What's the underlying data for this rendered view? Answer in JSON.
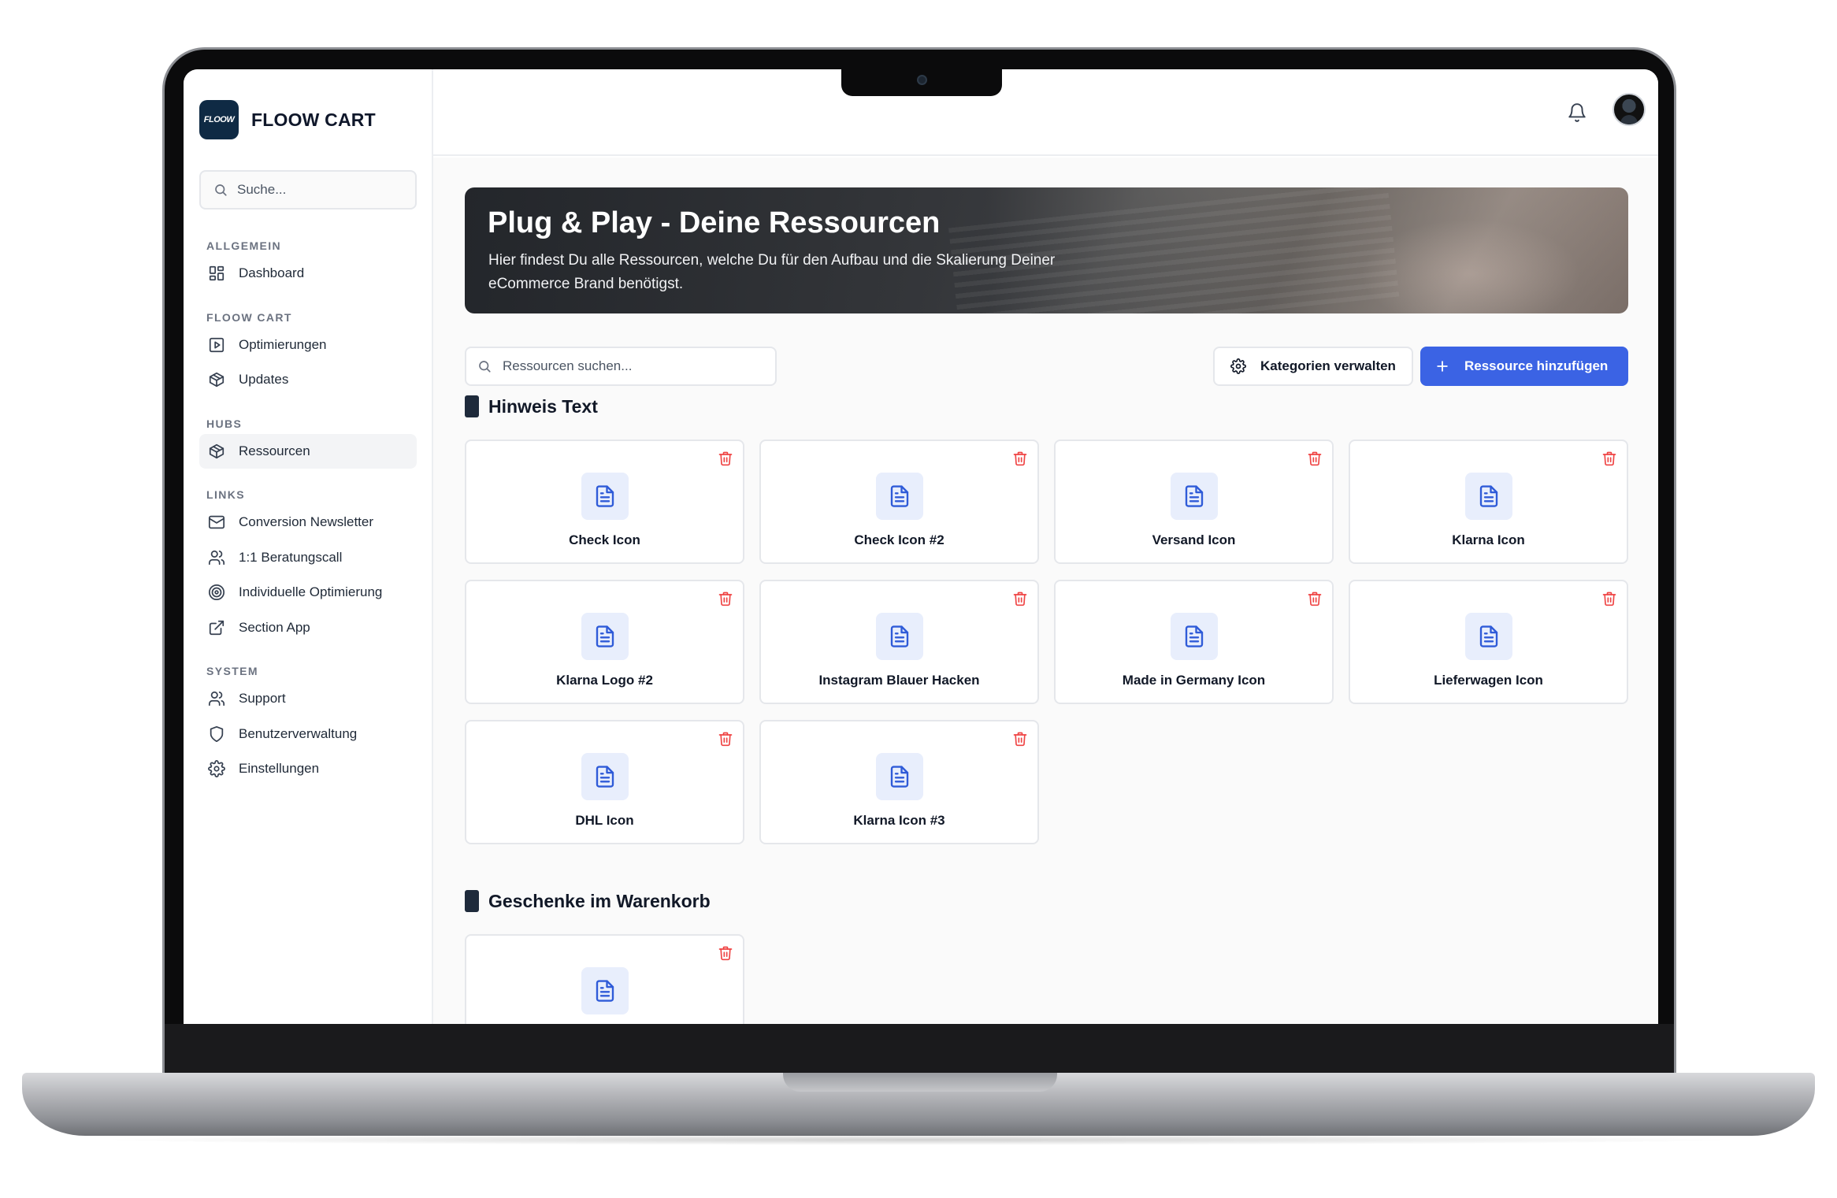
{
  "brand": {
    "logo_text": "FLOOW",
    "name": "FLOOW CART"
  },
  "sidebar": {
    "search_placeholder": "Suche...",
    "sections": [
      {
        "label": "ALLGEMEIN",
        "items": [
          {
            "label": "Dashboard",
            "icon": "grid-icon"
          }
        ]
      },
      {
        "label": "FLOOW CART",
        "items": [
          {
            "label": "Optimierungen",
            "icon": "play-square-icon"
          },
          {
            "label": "Updates",
            "icon": "box-icon"
          }
        ]
      },
      {
        "label": "HUBS",
        "items": [
          {
            "label": "Ressourcen",
            "icon": "box-icon",
            "active": true
          }
        ]
      },
      {
        "label": "LINKS",
        "items": [
          {
            "label": "Conversion Newsletter",
            "icon": "mail-icon"
          },
          {
            "label": "1:1 Beratungscall",
            "icon": "users-icon"
          },
          {
            "label": "Individuelle Optimierung",
            "icon": "target-icon"
          },
          {
            "label": "Section App",
            "icon": "external-link-icon"
          }
        ]
      },
      {
        "label": "SYSTEM",
        "items": [
          {
            "label": "Support",
            "icon": "users-icon"
          },
          {
            "label": "Benutzerverwaltung",
            "icon": "shield-icon"
          },
          {
            "label": "Einstellungen",
            "icon": "gear-icon"
          }
        ]
      }
    ]
  },
  "topbar": {
    "bell_icon": "bell-icon",
    "avatar_icon": "user-avatar"
  },
  "hero": {
    "title": "Plug & Play - Deine Ressourcen",
    "subtitle_line1": "Hier findest Du alle Ressourcen, welche Du für den Aufbau und die Skalierung Deiner",
    "subtitle_line2": "eCommerce Brand benötigst."
  },
  "toolbar": {
    "search_placeholder": "Ressourcen suchen...",
    "manage_categories_label": "Kategorien verwalten",
    "add_resource_label": "Ressource hinzufügen"
  },
  "categories": [
    {
      "title": "Hinweis Text",
      "resources": [
        "Check Icon",
        "Check Icon #2",
        "Versand Icon",
        "Klarna Icon",
        "Klarna Logo #2",
        "Instagram Blauer Hacken",
        "Made in Germany Icon",
        "Lieferwagen Icon",
        "DHL Icon",
        "Klarna Icon #3"
      ]
    },
    {
      "title": "Geschenke im Warenkorb",
      "resources": [
        ""
      ]
    }
  ],
  "colors": {
    "primary": "#3b63e4",
    "danger": "#ef4444",
    "doc_icon": "#2f5bd8",
    "doc_bg": "#e8eefc",
    "brand_dark": "#0f2a44"
  }
}
